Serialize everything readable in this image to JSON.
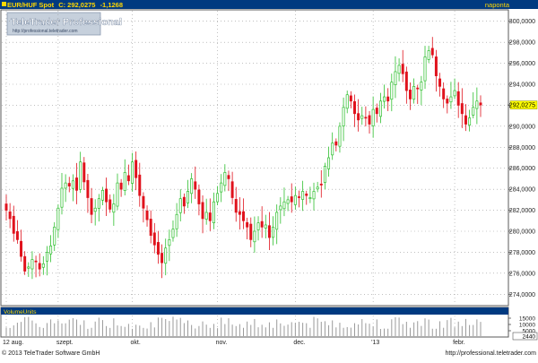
{
  "header": {
    "symbol": "EUR/HUF Spot",
    "last_label": "C: 292,0275",
    "change": "-1,1268",
    "period": "naponta"
  },
  "watermark": {
    "title": "TeleTrader Professional",
    "url": "http://professional.teletrader.com"
  },
  "volume_panel": {
    "title": "VolumeUnits",
    "last_value": "2440"
  },
  "footer": {
    "copyright": "© 2013 TeleTrader Software GmbH",
    "url": "http://professional.teletrader.com"
  },
  "colors": {
    "header_bg": "#003a80",
    "header_text": "#ffd700",
    "grid": "#9a9a9a",
    "up_candle": "#2fbf2f",
    "down_candle": "#e0121c",
    "last_value_bg": "#ffff00",
    "volume_bar": "#9a9a9a"
  },
  "chart_data": {
    "type": "candlestick",
    "instrument": "EUR/HUF Spot",
    "period": "naponta",
    "ylim": [
      273,
      301
    ],
    "y_ticks": [
      "300,0000",
      "298,0000",
      "296,0000",
      "294,0000",
      "292,0000",
      "290,0000",
      "288,0000",
      "286,0000",
      "284,0000",
      "282,0000",
      "280,0000",
      "278,0000",
      "276,0000",
      "274,0000"
    ],
    "last_value": "292,0275",
    "grid": true,
    "x_labels": [
      {
        "label": "12 aug.",
        "index": 0
      },
      {
        "label": "szept.",
        "index": 14
      },
      {
        "label": "okt.",
        "index": 34
      },
      {
        "label": "nov.",
        "index": 57
      },
      {
        "label": "dec.",
        "index": 78
      },
      {
        "label": "'13",
        "index": 99
      },
      {
        "label": "febr.",
        "index": 121
      }
    ],
    "close": [
      282.0,
      281.2,
      279.8,
      279.2,
      277.6,
      276.2,
      276.6,
      277.3,
      277.1,
      276.4,
      276.9,
      278.0,
      278.6,
      280.4,
      282.2,
      284.1,
      284.6,
      284.3,
      284.8,
      283.9,
      286.6,
      284.7,
      283.2,
      281.6,
      282.2,
      283.1,
      283.9,
      282.8,
      282.1,
      282.6,
      284.6,
      284.0,
      285.6,
      284.8,
      286.6,
      285.1,
      283.4,
      282.2,
      281.1,
      279.6,
      278.7,
      277.8,
      277.0,
      278.4,
      279.2,
      280.2,
      281.6,
      283.1,
      282.4,
      283.8,
      285.0,
      284.0,
      282.6,
      281.2,
      281.8,
      281.0,
      282.8,
      283.6,
      284.6,
      285.6,
      285.0,
      283.2,
      281.8,
      281.6,
      281.0,
      280.4,
      279.2,
      280.0,
      280.8,
      280.4,
      280.6,
      279.4,
      280.4,
      281.8,
      282.4,
      282.8,
      283.0,
      282.8,
      283.4,
      283.2,
      283.8,
      283.4,
      283.2,
      283.8,
      284.2,
      284.4,
      286.2,
      287.0,
      288.4,
      288.2,
      290.0,
      291.8,
      293.0,
      292.4,
      291.2,
      290.6,
      291.0,
      290.8,
      290.2,
      291.6,
      291.2,
      292.4,
      292.8,
      292.4,
      294.2,
      295.2,
      295.8,
      295.0,
      293.4,
      292.6,
      293.8,
      293.6,
      294.2,
      296.6,
      297.2,
      296.8,
      294.8,
      293.8,
      292.6,
      292.2,
      292.8,
      293.4,
      292.0,
      291.2,
      290.2,
      290.8,
      291.8,
      292.4,
      292.0275
    ]
  }
}
